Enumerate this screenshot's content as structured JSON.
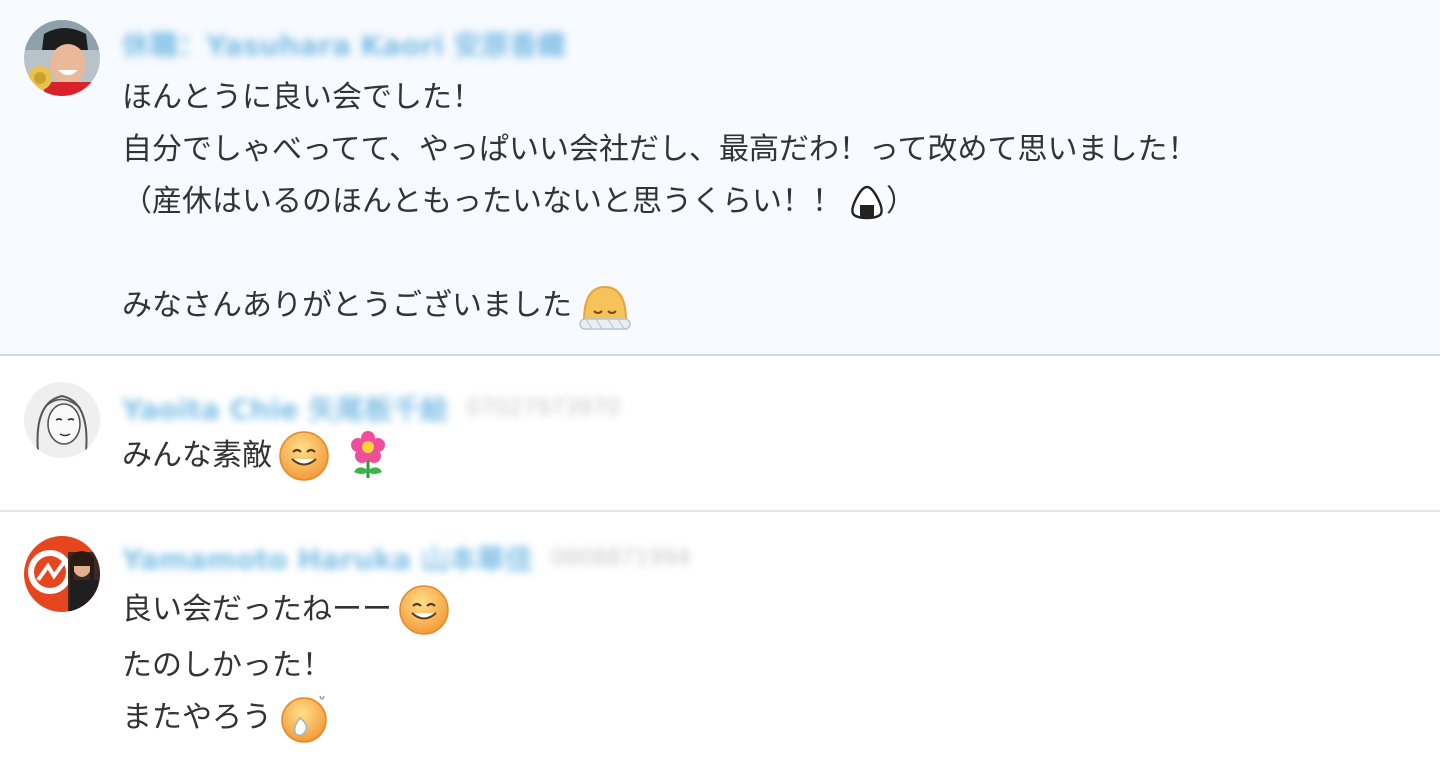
{
  "messages": [
    {
      "author": "休職：Yasuhara Kaori 安原香織",
      "timestamp": "",
      "lines": [
        "ほんとうに良い会でした！",
        "自分でしゃべってて、やっぱいい会社だし、最高だわ！って改めて思いました！",
        "（産休はいるのほんともったいないと思うくらい！！",
        "）",
        "",
        "みなさんありがとうございました"
      ],
      "emojis": [
        "onigiri-emoji",
        "bow-emoji"
      ]
    },
    {
      "author": "Yaoita Chie 矢尾板千絵",
      "timestamp": "07027973970",
      "lines": [
        "みんな素敵"
      ],
      "emojis": [
        "smile-emoji",
        "flower-emoji"
      ]
    },
    {
      "author": "Yamamoto Haruka 山本華佳",
      "timestamp": "0808871994",
      "lines": [
        "良い会だったねーー",
        "たのしかった！",
        "またやろう"
      ],
      "emojis": [
        "smile-emoji",
        "sweat-emoji"
      ]
    }
  ],
  "colors": {
    "author": "#2a95d6",
    "selected_bg": "#f7fafe",
    "selected_border": "#c9dced",
    "divider": "#e6e6e6",
    "text": "#333333"
  }
}
